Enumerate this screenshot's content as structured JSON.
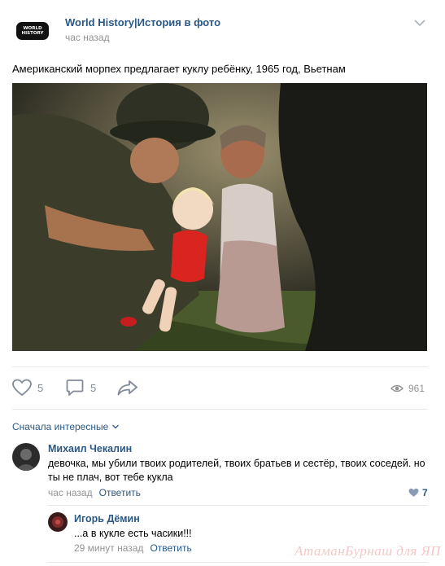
{
  "post": {
    "logo_line1": "WORLD",
    "logo_line2": "HISTORY",
    "author": "World History|История в фото",
    "time": "час назад",
    "text": "Американский морпех предлагает куклу ребёнку, 1965 год, Вьетнам"
  },
  "actions": {
    "likes": "5",
    "comments": "5",
    "views": "961"
  },
  "comments_sort": {
    "label": "Сначала интересные"
  },
  "comments": [
    {
      "name": "Михаил Чекалин",
      "text": "девочка, мы убили твоих родителей, твоих братьев и сестёр, твоих соседей. но ты не плач, вот тебе кукла",
      "time": "час назад",
      "reply": "Ответить",
      "likes": "7"
    },
    {
      "name": "Игорь Дёмин",
      "text": "...а в кукле есть часики!!!",
      "time": "29 минут назад",
      "reply": "Ответить"
    }
  ],
  "watermark": "АтаманБурнаш для ЯП",
  "colors": {
    "link": "#2a5885",
    "muted": "#939393",
    "divider": "#e7e8ec",
    "like_icon": "#5b7fa6"
  }
}
